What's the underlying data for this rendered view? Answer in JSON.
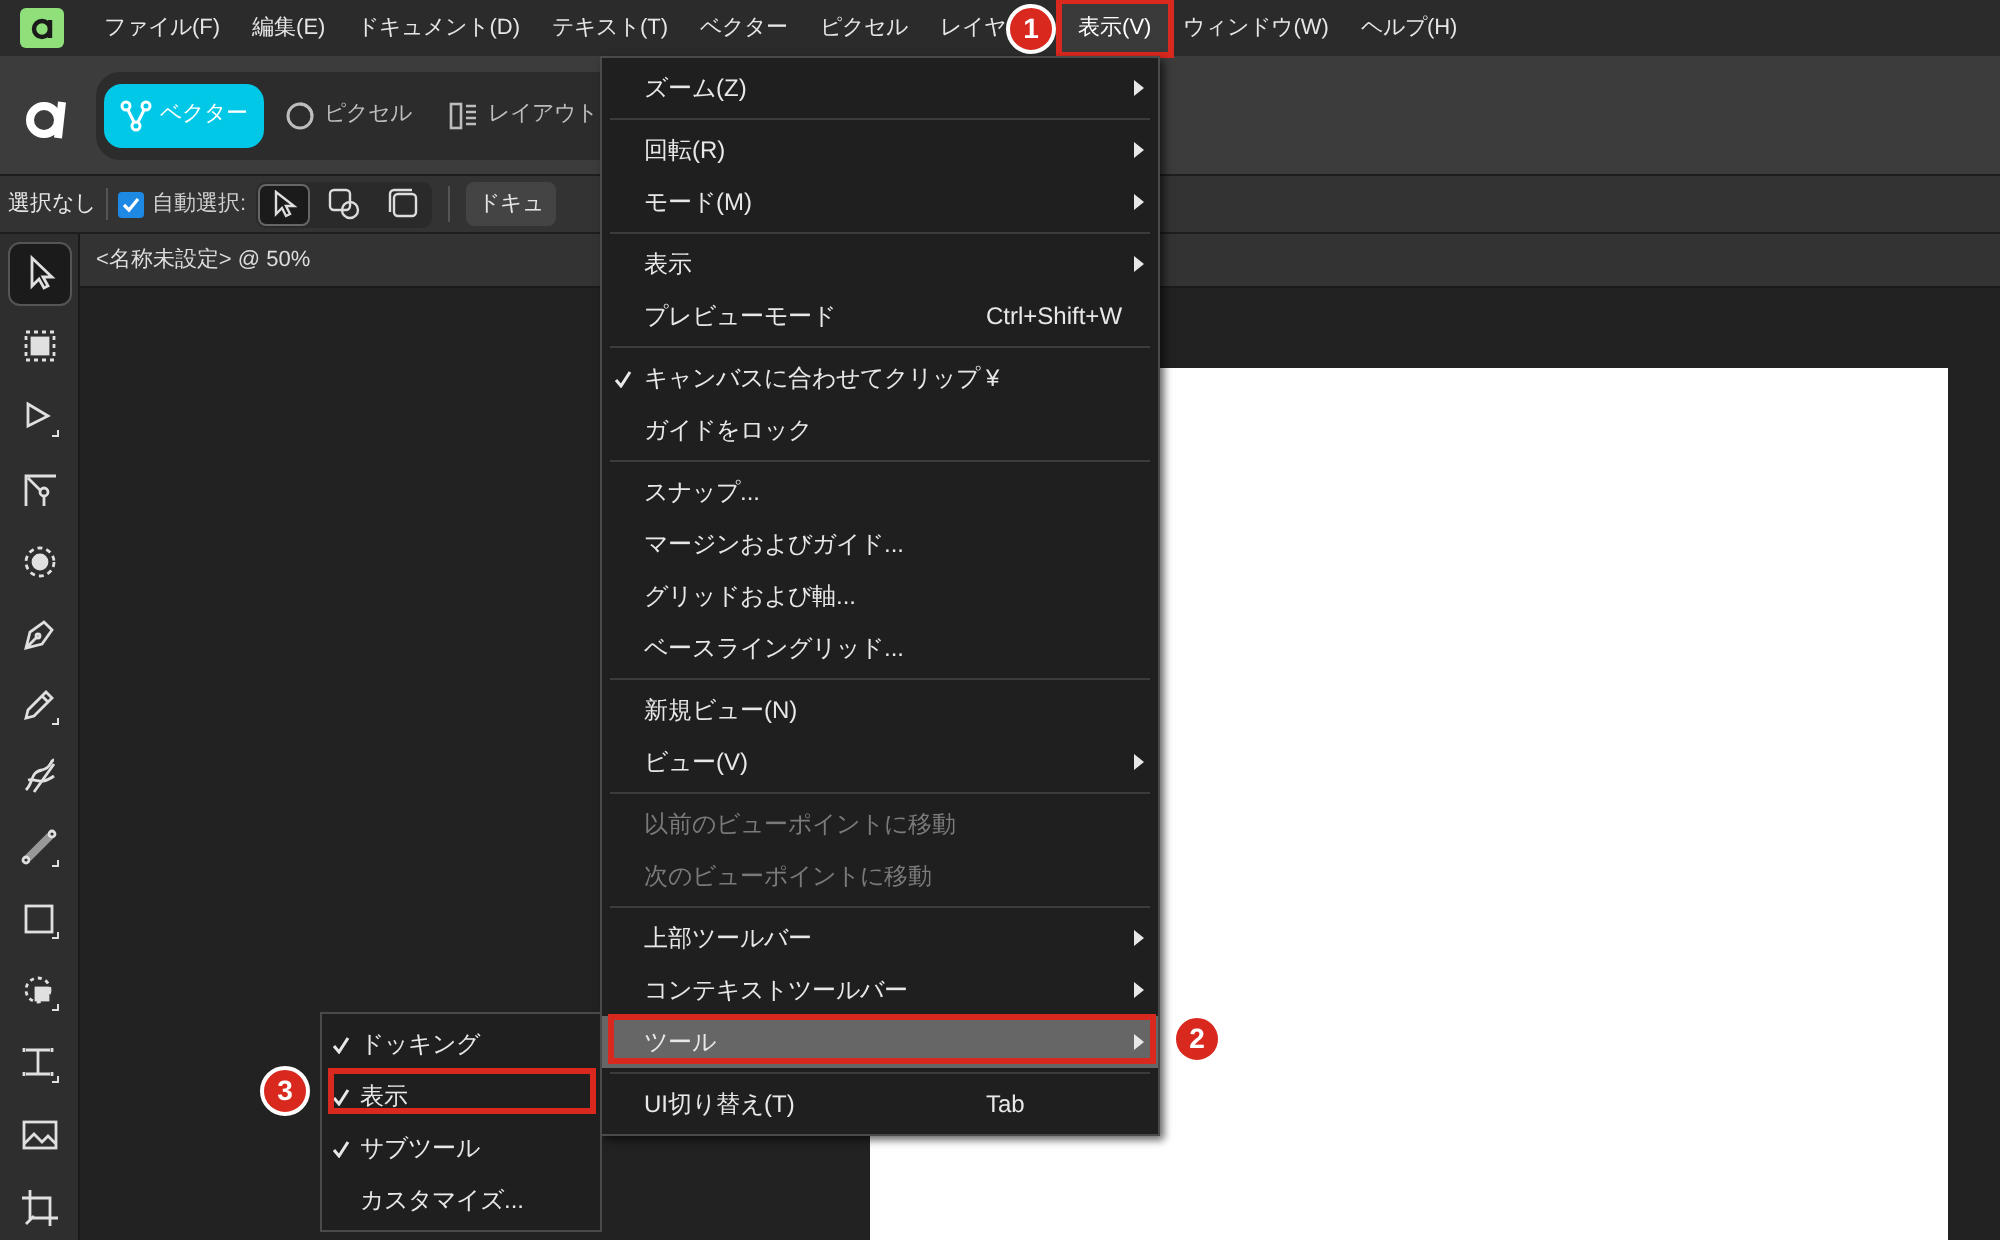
{
  "menubar": {
    "items": [
      {
        "label": "ファイル(F)",
        "selected": false
      },
      {
        "label": "編集(E)",
        "selected": false
      },
      {
        "label": "ドキュメント(D)",
        "selected": false
      },
      {
        "label": "テキスト(T)",
        "selected": false
      },
      {
        "label": "ベクター",
        "selected": false
      },
      {
        "label": "ピクセル",
        "selected": false
      },
      {
        "label": "レイヤ",
        "selected": false
      },
      {
        "label": "表示(V)",
        "selected": true
      },
      {
        "label": "ウィンドウ(W)",
        "selected": false
      },
      {
        "label": "ヘルプ(H)",
        "selected": false
      }
    ]
  },
  "personas": [
    {
      "kind": "vector",
      "label": "ベクター",
      "selected": true
    },
    {
      "kind": "pixel",
      "label": "ピクセル",
      "selected": false
    },
    {
      "kind": "layout",
      "label": "レイアウト",
      "selected": false
    }
  ],
  "context_bar": {
    "selection": "選択なし",
    "auto_select": {
      "label": "自動選択:",
      "checked": true
    },
    "modes": [
      {
        "kind": "pointer",
        "selected": true
      },
      {
        "kind": "overlap",
        "selected": false
      },
      {
        "kind": "stack",
        "selected": false
      }
    ],
    "document_button": "ドキュ"
  },
  "document_tab": "<名称未設定> @ 50%",
  "tools": [
    {
      "kind": "move",
      "selected": true
    },
    {
      "kind": "artboard",
      "selected": false
    },
    {
      "kind": "node",
      "selected": false
    },
    {
      "kind": "corner",
      "selected": false
    },
    {
      "kind": "transform",
      "selected": false
    },
    {
      "kind": "pen",
      "selected": false
    },
    {
      "kind": "pencil",
      "selected": false
    },
    {
      "kind": "brush",
      "selected": false
    },
    {
      "kind": "gradient",
      "selected": false
    },
    {
      "kind": "rectangle",
      "selected": false
    },
    {
      "kind": "fill",
      "selected": false
    },
    {
      "kind": "text",
      "selected": false
    },
    {
      "kind": "image",
      "selected": false
    },
    {
      "kind": "crop",
      "selected": false
    }
  ],
  "view_menu": {
    "groups": [
      [
        {
          "label": "ズーム(Z)",
          "submenu": true,
          "checked": false,
          "disabled": false,
          "selected": false
        }
      ],
      [
        {
          "label": "回転(R)",
          "submenu": true,
          "checked": false,
          "disabled": false,
          "selected": false
        },
        {
          "label": "モード(M)",
          "submenu": true,
          "checked": false,
          "disabled": false,
          "selected": false
        }
      ],
      [
        {
          "label": "表示",
          "submenu": true,
          "checked": false,
          "disabled": false,
          "selected": false
        },
        {
          "label": "プレビューモード",
          "shortcut": "Ctrl+Shift+W",
          "submenu": false,
          "checked": false,
          "disabled": false,
          "selected": false
        }
      ],
      [
        {
          "label": "キャンバスに合わせてクリップ",
          "shortcut": "¥",
          "submenu": false,
          "checked": true,
          "disabled": false,
          "selected": false
        },
        {
          "label": "ガイドをロック",
          "submenu": false,
          "checked": false,
          "disabled": false,
          "selected": false
        }
      ],
      [
        {
          "label": "スナップ...",
          "submenu": false,
          "checked": false,
          "disabled": false,
          "selected": false
        },
        {
          "label": "マージンおよびガイド...",
          "submenu": false,
          "checked": false,
          "disabled": false,
          "selected": false
        },
        {
          "label": "グリッドおよび軸...",
          "submenu": false,
          "checked": false,
          "disabled": false,
          "selected": false
        },
        {
          "label": "ベースライングリッド...",
          "submenu": false,
          "checked": false,
          "disabled": false,
          "selected": false
        }
      ],
      [
        {
          "label": "新規ビュー(N)",
          "submenu": false,
          "checked": false,
          "disabled": false,
          "selected": false
        },
        {
          "label": "ビュー(V)",
          "submenu": true,
          "checked": false,
          "disabled": false,
          "selected": false
        }
      ],
      [
        {
          "label": "以前のビューポイントに移動",
          "submenu": false,
          "checked": false,
          "disabled": true,
          "selected": false
        },
        {
          "label": "次のビューポイントに移動",
          "submenu": false,
          "checked": false,
          "disabled": true,
          "selected": false
        }
      ],
      [
        {
          "label": "上部ツールバー",
          "submenu": true,
          "checked": false,
          "disabled": false,
          "selected": false
        },
        {
          "label": "コンテキストツールバー",
          "submenu": true,
          "checked": false,
          "disabled": false,
          "selected": false
        },
        {
          "label": "ツール",
          "submenu": true,
          "checked": false,
          "disabled": false,
          "selected": true
        }
      ],
      [
        {
          "label": "UI切り替え(T)",
          "shortcut": "Tab",
          "submenu": false,
          "checked": false,
          "disabled": false,
          "selected": false
        }
      ]
    ]
  },
  "tools_submenu": {
    "items": [
      {
        "label": "ドッキング",
        "checked": true
      },
      {
        "label": "表示",
        "checked": true
      },
      {
        "label": "サブツール",
        "checked": true
      },
      {
        "label": "カスタマイズ...",
        "checked": false
      }
    ]
  },
  "annotations": [
    {
      "label": "1"
    },
    {
      "label": "2"
    },
    {
      "label": "3"
    }
  ]
}
